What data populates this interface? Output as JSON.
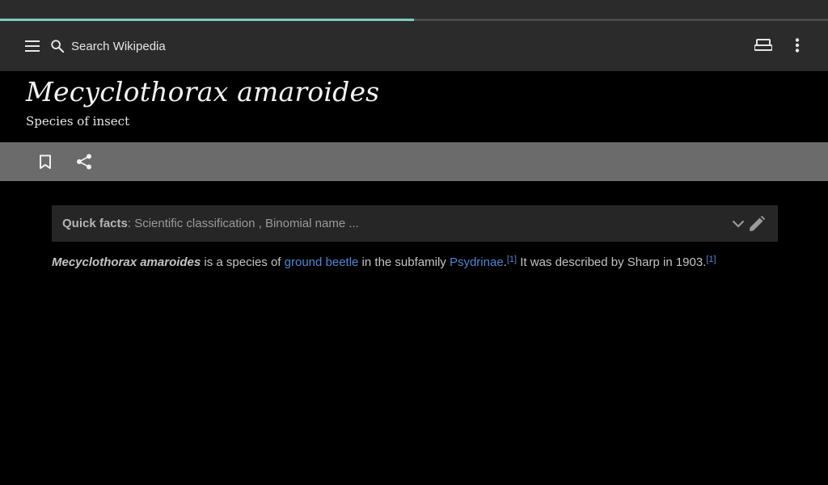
{
  "loading_progress": 0.5,
  "toolbar": {
    "menu_icon": "menu-icon",
    "search_icon": "search-icon",
    "search_placeholder": "Search Wikipedia",
    "reading_lists_icon": "reading-list-icon",
    "overflow_icon": "more-vertical-icon"
  },
  "article": {
    "title": "Mecyclothorax amaroides",
    "subtitle": "Species of insect",
    "actions": {
      "bookmark_icon": "bookmark-icon",
      "share_icon": "share-icon"
    },
    "quick_facts": {
      "label": "Quick facts",
      "separator": ": ",
      "summary": "Scientific classification , Binomial name ...",
      "expand_icon": "chevron-down-icon",
      "edit_icon": "pencil-icon"
    },
    "lead": {
      "subject": "Mecyclothorax amaroides",
      "text_1": " is a species of ",
      "link_1": "ground beetle",
      "text_2": " in the subfamily ",
      "link_2": "Psydrinae",
      "text_3": ".",
      "ref_1": "[1]",
      "text_4": " It was described by Sharp in 1903.",
      "ref_2": "[1]"
    }
  },
  "colors": {
    "background": "#000000",
    "toolbar": "#2b2b2b",
    "action_bar": "#6b6b6b",
    "progress": "#7fc8c0",
    "link": "#4e86d6"
  }
}
